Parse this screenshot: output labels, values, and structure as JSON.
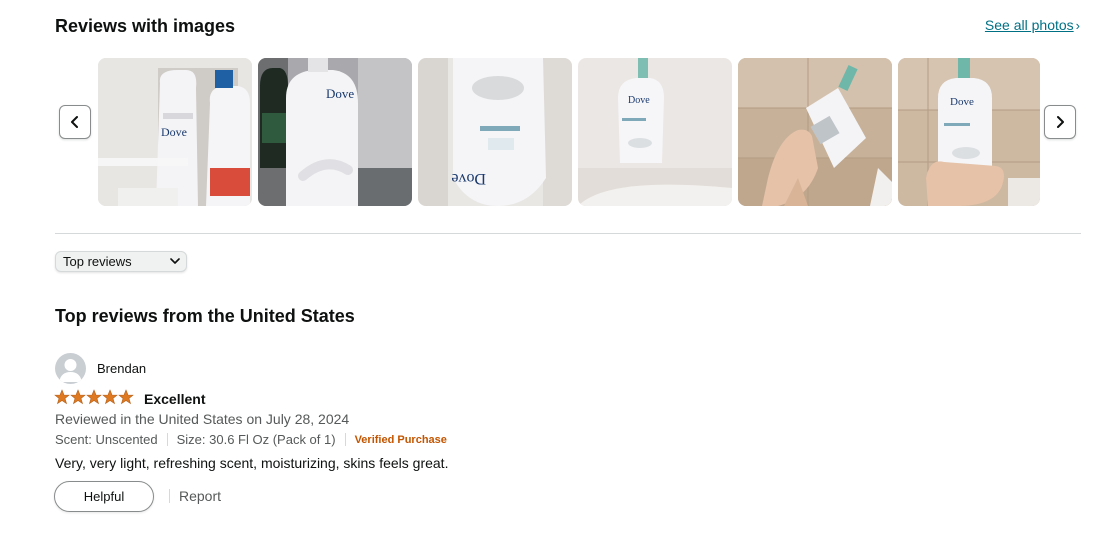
{
  "images_section": {
    "title": "Reviews with images",
    "see_all_label": "See all photos",
    "see_all_chevron": "›",
    "prev_icon": "chevron-left-icon",
    "next_icon": "chevron-right-icon",
    "thumbnails": [
      {
        "name": "review-photo-1",
        "brand_text": "Dove"
      },
      {
        "name": "review-photo-2",
        "brand_text": "Dove"
      },
      {
        "name": "review-photo-3",
        "brand_text": "Dove"
      },
      {
        "name": "review-photo-4",
        "brand_text": "Dove"
      },
      {
        "name": "review-photo-5",
        "brand_text": ""
      },
      {
        "name": "review-photo-6",
        "brand_text": "Dove"
      }
    ]
  },
  "sort": {
    "selected": "Top reviews",
    "caret_icon": "chevron-down-icon"
  },
  "reviews_heading": "Top reviews from the United States",
  "review": {
    "reviewer_name": "Brendan",
    "avatar_icon": "user-avatar-icon",
    "rating": 5,
    "rating_max": 5,
    "title": "Excellent",
    "date_line": "Reviewed in the United States on July 28, 2024",
    "scent": "Scent: Unscented",
    "size": "Size: 30.6 Fl Oz (Pack of 1)",
    "verified": "Verified Purchase",
    "body": "Very, very light, refreshing scent, moisturizing, skins feels great.",
    "helpful_label": "Helpful",
    "report_label": "Report"
  },
  "colors": {
    "link": "#007185",
    "star": "#de7921",
    "verified": "#c45500",
    "muted_text": "#565959"
  }
}
